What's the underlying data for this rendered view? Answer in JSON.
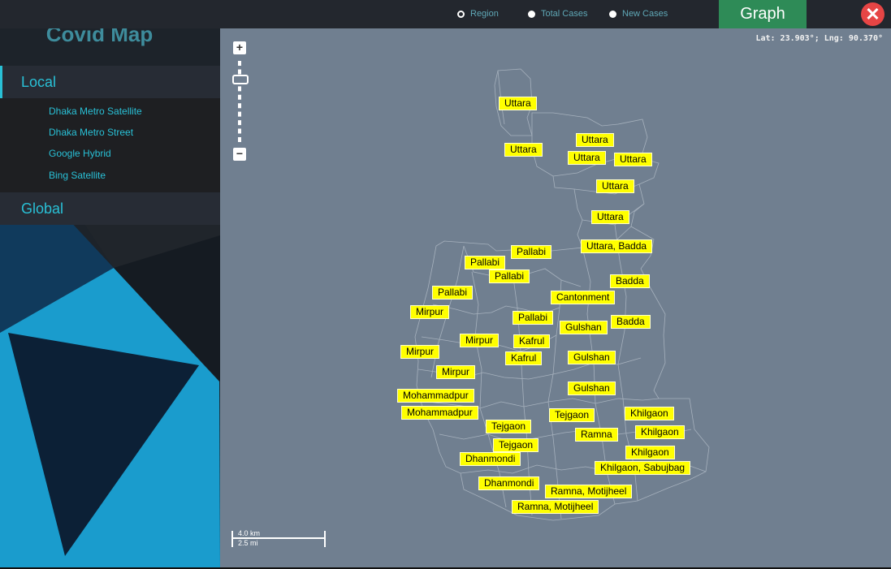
{
  "app": {
    "title": "Covid Map"
  },
  "topbar": {
    "radios": [
      {
        "label": "Region",
        "selected": true
      },
      {
        "label": "Total Cases",
        "selected": false
      },
      {
        "label": "New Cases",
        "selected": false
      }
    ],
    "graph_label": "Graph",
    "close_icon": "close-icon"
  },
  "sidebar": {
    "local": {
      "label": "Local",
      "items": [
        "Dhaka Metro Satellite",
        "Dhaka Metro Street",
        "Google Hybrid",
        "Bing Satellite"
      ]
    },
    "global": {
      "label": "Global"
    }
  },
  "map": {
    "coordinates": "Lat: 23.903°; Lng: 90.370°",
    "zoom_in": "+",
    "zoom_out": "−",
    "scale": {
      "km": "4.0 km",
      "mi": "2.5 mi"
    },
    "labels": [
      "Uttara",
      "Uttara",
      "Uttara",
      "Uttara",
      "Uttara",
      "Uttara",
      "Uttara",
      "Uttara, Badda",
      "Pallabi",
      "Pallabi",
      "Pallabi",
      "Pallabi",
      "Cantonment",
      "Badda",
      "Mirpur",
      "Pallabi",
      "Badda",
      "Gulshan",
      "Mirpur",
      "Kafrul",
      "Mirpur",
      "Kafrul",
      "Gulshan",
      "Mirpur",
      "Gulshan",
      "Mohammadpur",
      "Mohammadpur",
      "Khilgaon",
      "Tejgaon",
      "Tejgaon",
      "Khilgaon",
      "Ramna",
      "Tejgaon",
      "Khilgaon",
      "Dhanmondi",
      "Khilgaon, Sabujbag",
      "Dhanmondi",
      "Ramna, Motijheel",
      "Ramna, Motijheel"
    ]
  }
}
